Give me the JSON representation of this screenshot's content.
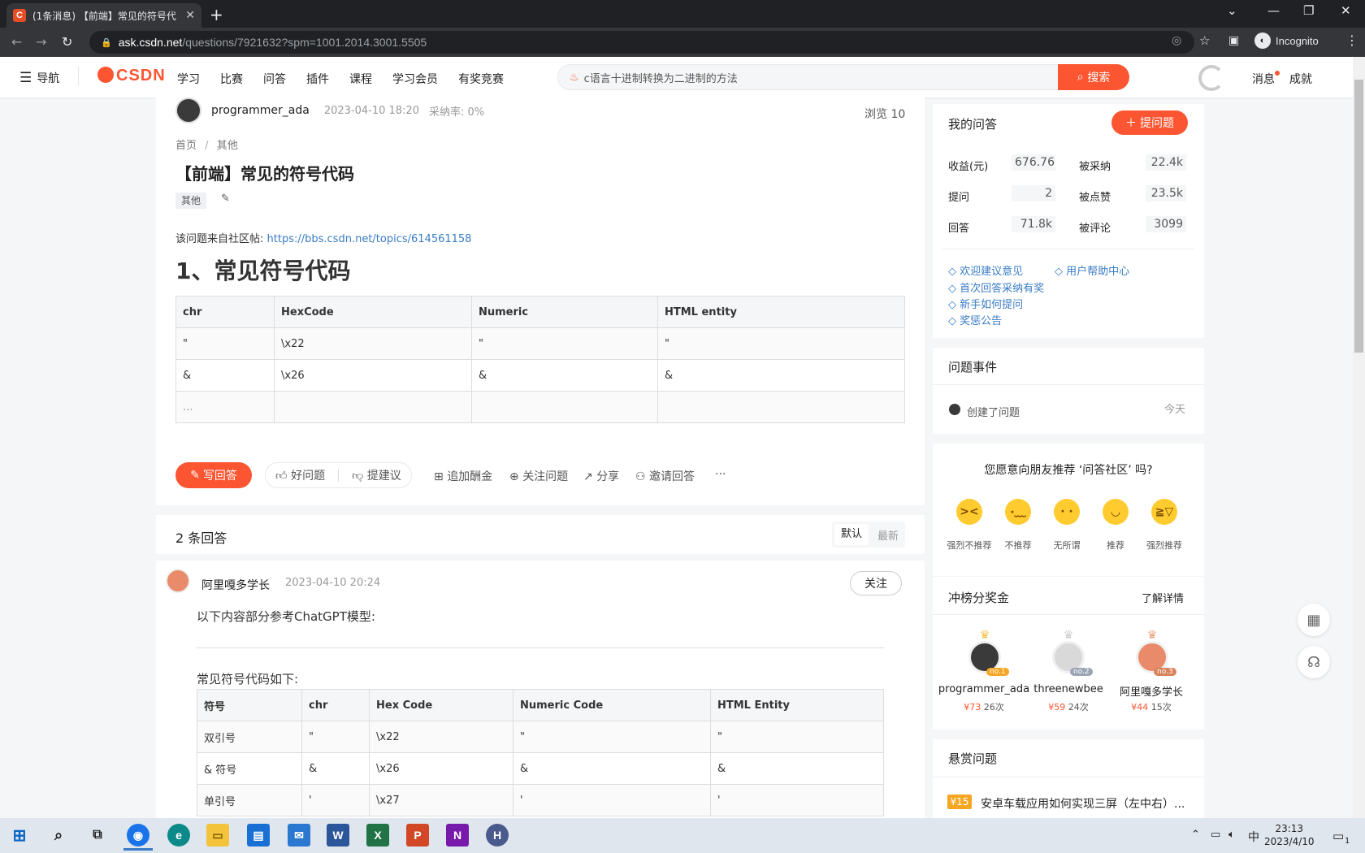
{
  "browser": {
    "tab_title": "(1条消息) 【前端】常见的符号代",
    "tab_favicon": "C",
    "new_tab": "+",
    "url_host": "ask.csdn.net",
    "url_path": "/questions/7921632?spm=1001.2014.3001.5505",
    "incognito_label": "Incognito"
  },
  "header": {
    "nav_label": "导航",
    "logo": "CSDN",
    "menu": [
      "学习",
      "比赛",
      "问答",
      "插件",
      "课程",
      "学习会员",
      "有奖竞赛"
    ],
    "search_placeholder": "c语言十进制转换为二进制的方法",
    "search_button": "搜索",
    "messages": "消息",
    "achievements": "成就"
  },
  "question": {
    "author": "programmer_ada",
    "time": "2023-04-10 18:20",
    "accept_rate": "采纳率: 0%",
    "views": "浏览 10",
    "breadcrumb_home": "首页",
    "breadcrumb_sep": "/",
    "breadcrumb_cat": "其他",
    "title": "【前端】常见的符号代码",
    "tag": "其他",
    "source_prefix": "该问题来自社区帖:",
    "source_link": "https://bbs.csdn.net/topics/614561158",
    "heading": "1、常见符号代码",
    "table_headers": [
      "chr",
      "HexCode",
      "Numeric",
      "HTML entity"
    ],
    "table_rows": [
      [
        "\"",
        "\\x22",
        "\"",
        "\""
      ],
      [
        "&",
        "\\x26",
        "&",
        "&"
      ],
      [
        "...",
        "",
        "",
        ""
      ]
    ],
    "actions": {
      "write": "写回答",
      "good": "好问题",
      "suggest": "提建议",
      "bounty": "追加酬金",
      "follow": "关注问题",
      "share": "分享",
      "invite": "邀请回答",
      "more": "···"
    }
  },
  "answers": {
    "count_label": "2 条回答",
    "sort_default": "默认",
    "sort_latest": "最新",
    "first": {
      "author": "阿里嘎多学长",
      "time": "2023-04-10 20:24",
      "follow": "关注",
      "intro": "以下内容部分参考ChatGPT模型:",
      "lead": "常见符号代码如下:",
      "table_headers": [
        "符号",
        "chr",
        "Hex Code",
        "Numeric Code",
        "HTML Entity"
      ],
      "table_rows": [
        [
          "双引号",
          "\"",
          "\\x22",
          "\"",
          "\""
        ],
        [
          "& 符号",
          "&",
          "\\x26",
          "&",
          "&"
        ],
        [
          "单引号",
          "'",
          "\\x27",
          "'",
          "'"
        ]
      ]
    }
  },
  "sidebar": {
    "my_qa_title": "我的问答",
    "ask_button": "提问题",
    "stats": [
      {
        "label": "收益(元)",
        "value": "676.76"
      },
      {
        "label": "被采纳",
        "value": "22.4k"
      },
      {
        "label": "提问",
        "value": "2"
      },
      {
        "label": "被点赞",
        "value": "23.5k"
      },
      {
        "label": "回答",
        "value": "71.8k"
      },
      {
        "label": "被评论",
        "value": "3099"
      }
    ],
    "links": [
      "欢迎建议意见",
      "用户帮助中心",
      "首次回答采纳有奖",
      "新手如何提问",
      "奖惩公告"
    ],
    "events_title": "问题事件",
    "event_text": "创建了问题",
    "event_time": "今天",
    "recommend_question": "您愿意向朋友推荐 ‘问答社区’ 吗?",
    "recommend_options": [
      "强烈不推荐",
      "不推荐",
      "无所谓",
      "推荐",
      "强烈推荐"
    ],
    "rank_title": "冲榜分奖金",
    "rank_more": "了解详情",
    "ranks": [
      {
        "name": "programmer_ada",
        "money": "¥73",
        "count": "26次",
        "badge": "no.1",
        "color": "#3a3a3a"
      },
      {
        "name": "threenewbee",
        "money": "¥59",
        "count": "24次",
        "badge": "no.2",
        "color": "#c9c9c9"
      },
      {
        "name": "阿里嘎多学长",
        "money": "¥44",
        "count": "15次",
        "badge": "no.3",
        "color": "#e98b6a"
      }
    ],
    "bounty_title": "悬赏问题",
    "bounty_tag": "¥15",
    "bounty_text": "安卓车载应用如何实现三屏（左中右）..."
  },
  "taskbar": {
    "time": "23:13",
    "date": "2023/4/10",
    "ime": "中",
    "notif_count": "1"
  }
}
